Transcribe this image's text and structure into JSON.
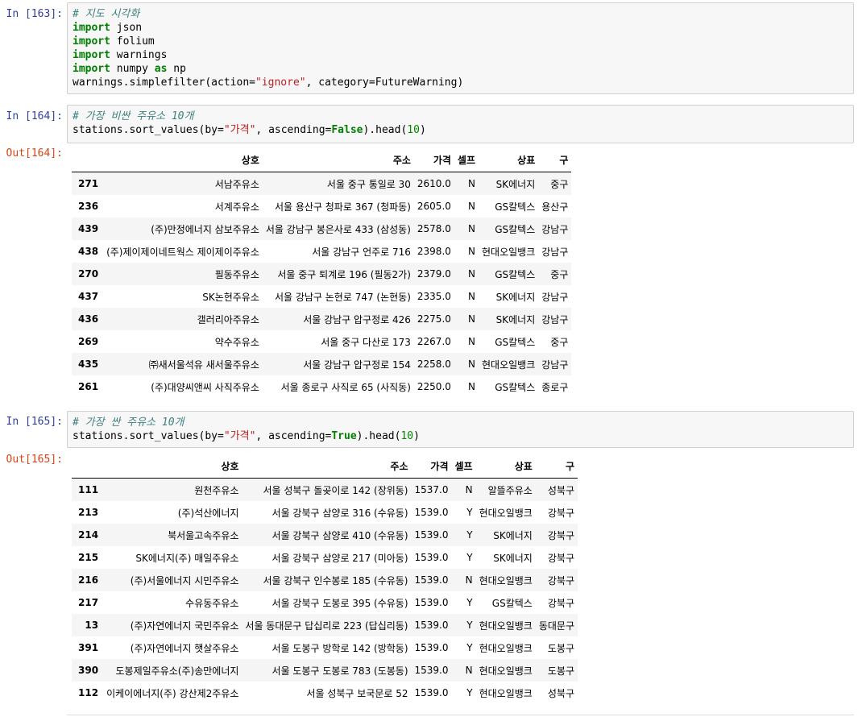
{
  "cells": [
    {
      "in_prompt": "In [163]:",
      "code_lines": [
        [
          {
            "t": "# 지도 시각화",
            "c": "com"
          }
        ],
        [
          {
            "t": "import",
            "c": "kw"
          },
          {
            "t": " json",
            "c": ""
          }
        ],
        [
          {
            "t": "import",
            "c": "kw"
          },
          {
            "t": " folium",
            "c": ""
          }
        ],
        [
          {
            "t": "import",
            "c": "kw"
          },
          {
            "t": " warnings",
            "c": ""
          }
        ],
        [
          {
            "t": "import",
            "c": "kw"
          },
          {
            "t": " numpy ",
            "c": ""
          },
          {
            "t": "as",
            "c": "kw"
          },
          {
            "t": " np",
            "c": ""
          }
        ],
        [
          {
            "t": "warnings.simplefilter(action=",
            "c": ""
          },
          {
            "t": "\"ignore\"",
            "c": "str"
          },
          {
            "t": ", category=FutureWarning)",
            "c": ""
          }
        ]
      ]
    },
    {
      "in_prompt": "In [164]:",
      "code_lines": [
        [
          {
            "t": "# 가장 비싼 주유소 10개",
            "c": "com"
          }
        ],
        [
          {
            "t": "stations.sort_values(by=",
            "c": ""
          },
          {
            "t": "\"가격\"",
            "c": "str"
          },
          {
            "t": ", ascending=",
            "c": ""
          },
          {
            "t": "False",
            "c": "kw"
          },
          {
            "t": ").head(",
            "c": ""
          },
          {
            "t": "10",
            "c": "num"
          },
          {
            "t": ")",
            "c": ""
          }
        ]
      ],
      "out_prompt": "Out[164]:",
      "table": {
        "columns": [
          "",
          "상호",
          "주소",
          "가격",
          "셀프",
          "상표",
          "구"
        ],
        "rows": [
          [
            "271",
            "서남주유소",
            "서울 중구 통일로 30",
            "2610.0",
            "N",
            "SK에너지",
            "중구"
          ],
          [
            "236",
            "서계주유소",
            "서울 용산구 청파로 367 (청파동)",
            "2605.0",
            "N",
            "GS칼텍스",
            "용산구"
          ],
          [
            "439",
            "(주)만정에너지 삼보주유소",
            "서울 강남구 봉은사로 433 (삼성동)",
            "2578.0",
            "N",
            "GS칼텍스",
            "강남구"
          ],
          [
            "438",
            "(주)제이제이네트웍스 제이제이주유소",
            "서울 강남구 언주로 716",
            "2398.0",
            "N",
            "현대오일뱅크",
            "강남구"
          ],
          [
            "270",
            "필동주유소",
            "서울 중구 퇴계로 196 (필동2가)",
            "2379.0",
            "N",
            "GS칼텍스",
            "중구"
          ],
          [
            "437",
            "SK논현주유소",
            "서울 강남구 논현로 747 (논현동)",
            "2335.0",
            "N",
            "SK에너지",
            "강남구"
          ],
          [
            "436",
            "갤러리아주유소",
            "서울 강남구 압구정로 426",
            "2275.0",
            "N",
            "SK에너지",
            "강남구"
          ],
          [
            "269",
            "약수주유소",
            "서울 중구 다산로 173",
            "2267.0",
            "N",
            "GS칼텍스",
            "중구"
          ],
          [
            "435",
            "㈜새서울석유 새서울주유소",
            "서울 강남구 압구정로 154",
            "2258.0",
            "N",
            "현대오일뱅크",
            "강남구"
          ],
          [
            "261",
            "(주)대양씨앤씨 사직주유소",
            "서울 종로구 사직로 65 (사직동)",
            "2250.0",
            "N",
            "GS칼텍스",
            "종로구"
          ]
        ]
      }
    },
    {
      "in_prompt": "In [165]:",
      "code_lines": [
        [
          {
            "t": "# 가장 싼 주유소 10개",
            "c": "com"
          }
        ],
        [
          {
            "t": "stations.sort_values(by=",
            "c": ""
          },
          {
            "t": "\"가격\"",
            "c": "str"
          },
          {
            "t": ", ascending=",
            "c": ""
          },
          {
            "t": "True",
            "c": "kw"
          },
          {
            "t": ").head(",
            "c": ""
          },
          {
            "t": "10",
            "c": "num"
          },
          {
            "t": ")",
            "c": ""
          }
        ]
      ],
      "out_prompt": "Out[165]:",
      "table": {
        "columns": [
          "",
          "상호",
          "주소",
          "가격",
          "셀프",
          "상표",
          "구"
        ],
        "rows": [
          [
            "111",
            "원천주유소",
            "서울 성북구 돌곶이로 142 (장위동)",
            "1537.0",
            "N",
            "알뜰주유소",
            "성북구"
          ],
          [
            "213",
            "(주)석산에너지",
            "서울 강북구 삼양로 316 (수유동)",
            "1539.0",
            "Y",
            "현대오일뱅크",
            "강북구"
          ],
          [
            "214",
            "북서울고속주유소",
            "서울 강북구 삼양로 410 (수유동)",
            "1539.0",
            "Y",
            "SK에너지",
            "강북구"
          ],
          [
            "215",
            "SK에너지(주) 매일주유소",
            "서울 강북구 삼양로 217 (미아동)",
            "1539.0",
            "Y",
            "SK에너지",
            "강북구"
          ],
          [
            "216",
            "(주)서울에너지 시민주유소",
            "서울 강북구 인수봉로 185 (수유동)",
            "1539.0",
            "N",
            "현대오일뱅크",
            "강북구"
          ],
          [
            "217",
            "수유동주유소",
            "서울 강북구 도봉로 395 (수유동)",
            "1539.0",
            "Y",
            "GS칼텍스",
            "강북구"
          ],
          [
            "13",
            "(주)자연에너지 국민주유소",
            "서울 동대문구 답십리로 223 (답십리동)",
            "1539.0",
            "Y",
            "현대오일뱅크",
            "동대문구"
          ],
          [
            "391",
            "(주)자연에너지 햇살주유소",
            "서울 도봉구 방학로 142 (방학동)",
            "1539.0",
            "Y",
            "현대오일뱅크",
            "도봉구"
          ],
          [
            "390",
            "도봉제일주유소(주)송만에너지",
            "서울 도봉구 도봉로 783 (도봉동)",
            "1539.0",
            "N",
            "현대오일뱅크",
            "도봉구"
          ],
          [
            "112",
            "이케이에너지(주) 강산제2주유소",
            "서울 성북구 보국문로 52",
            "1539.0",
            "Y",
            "현대오일뱅크",
            "성북구"
          ]
        ]
      }
    }
  ]
}
